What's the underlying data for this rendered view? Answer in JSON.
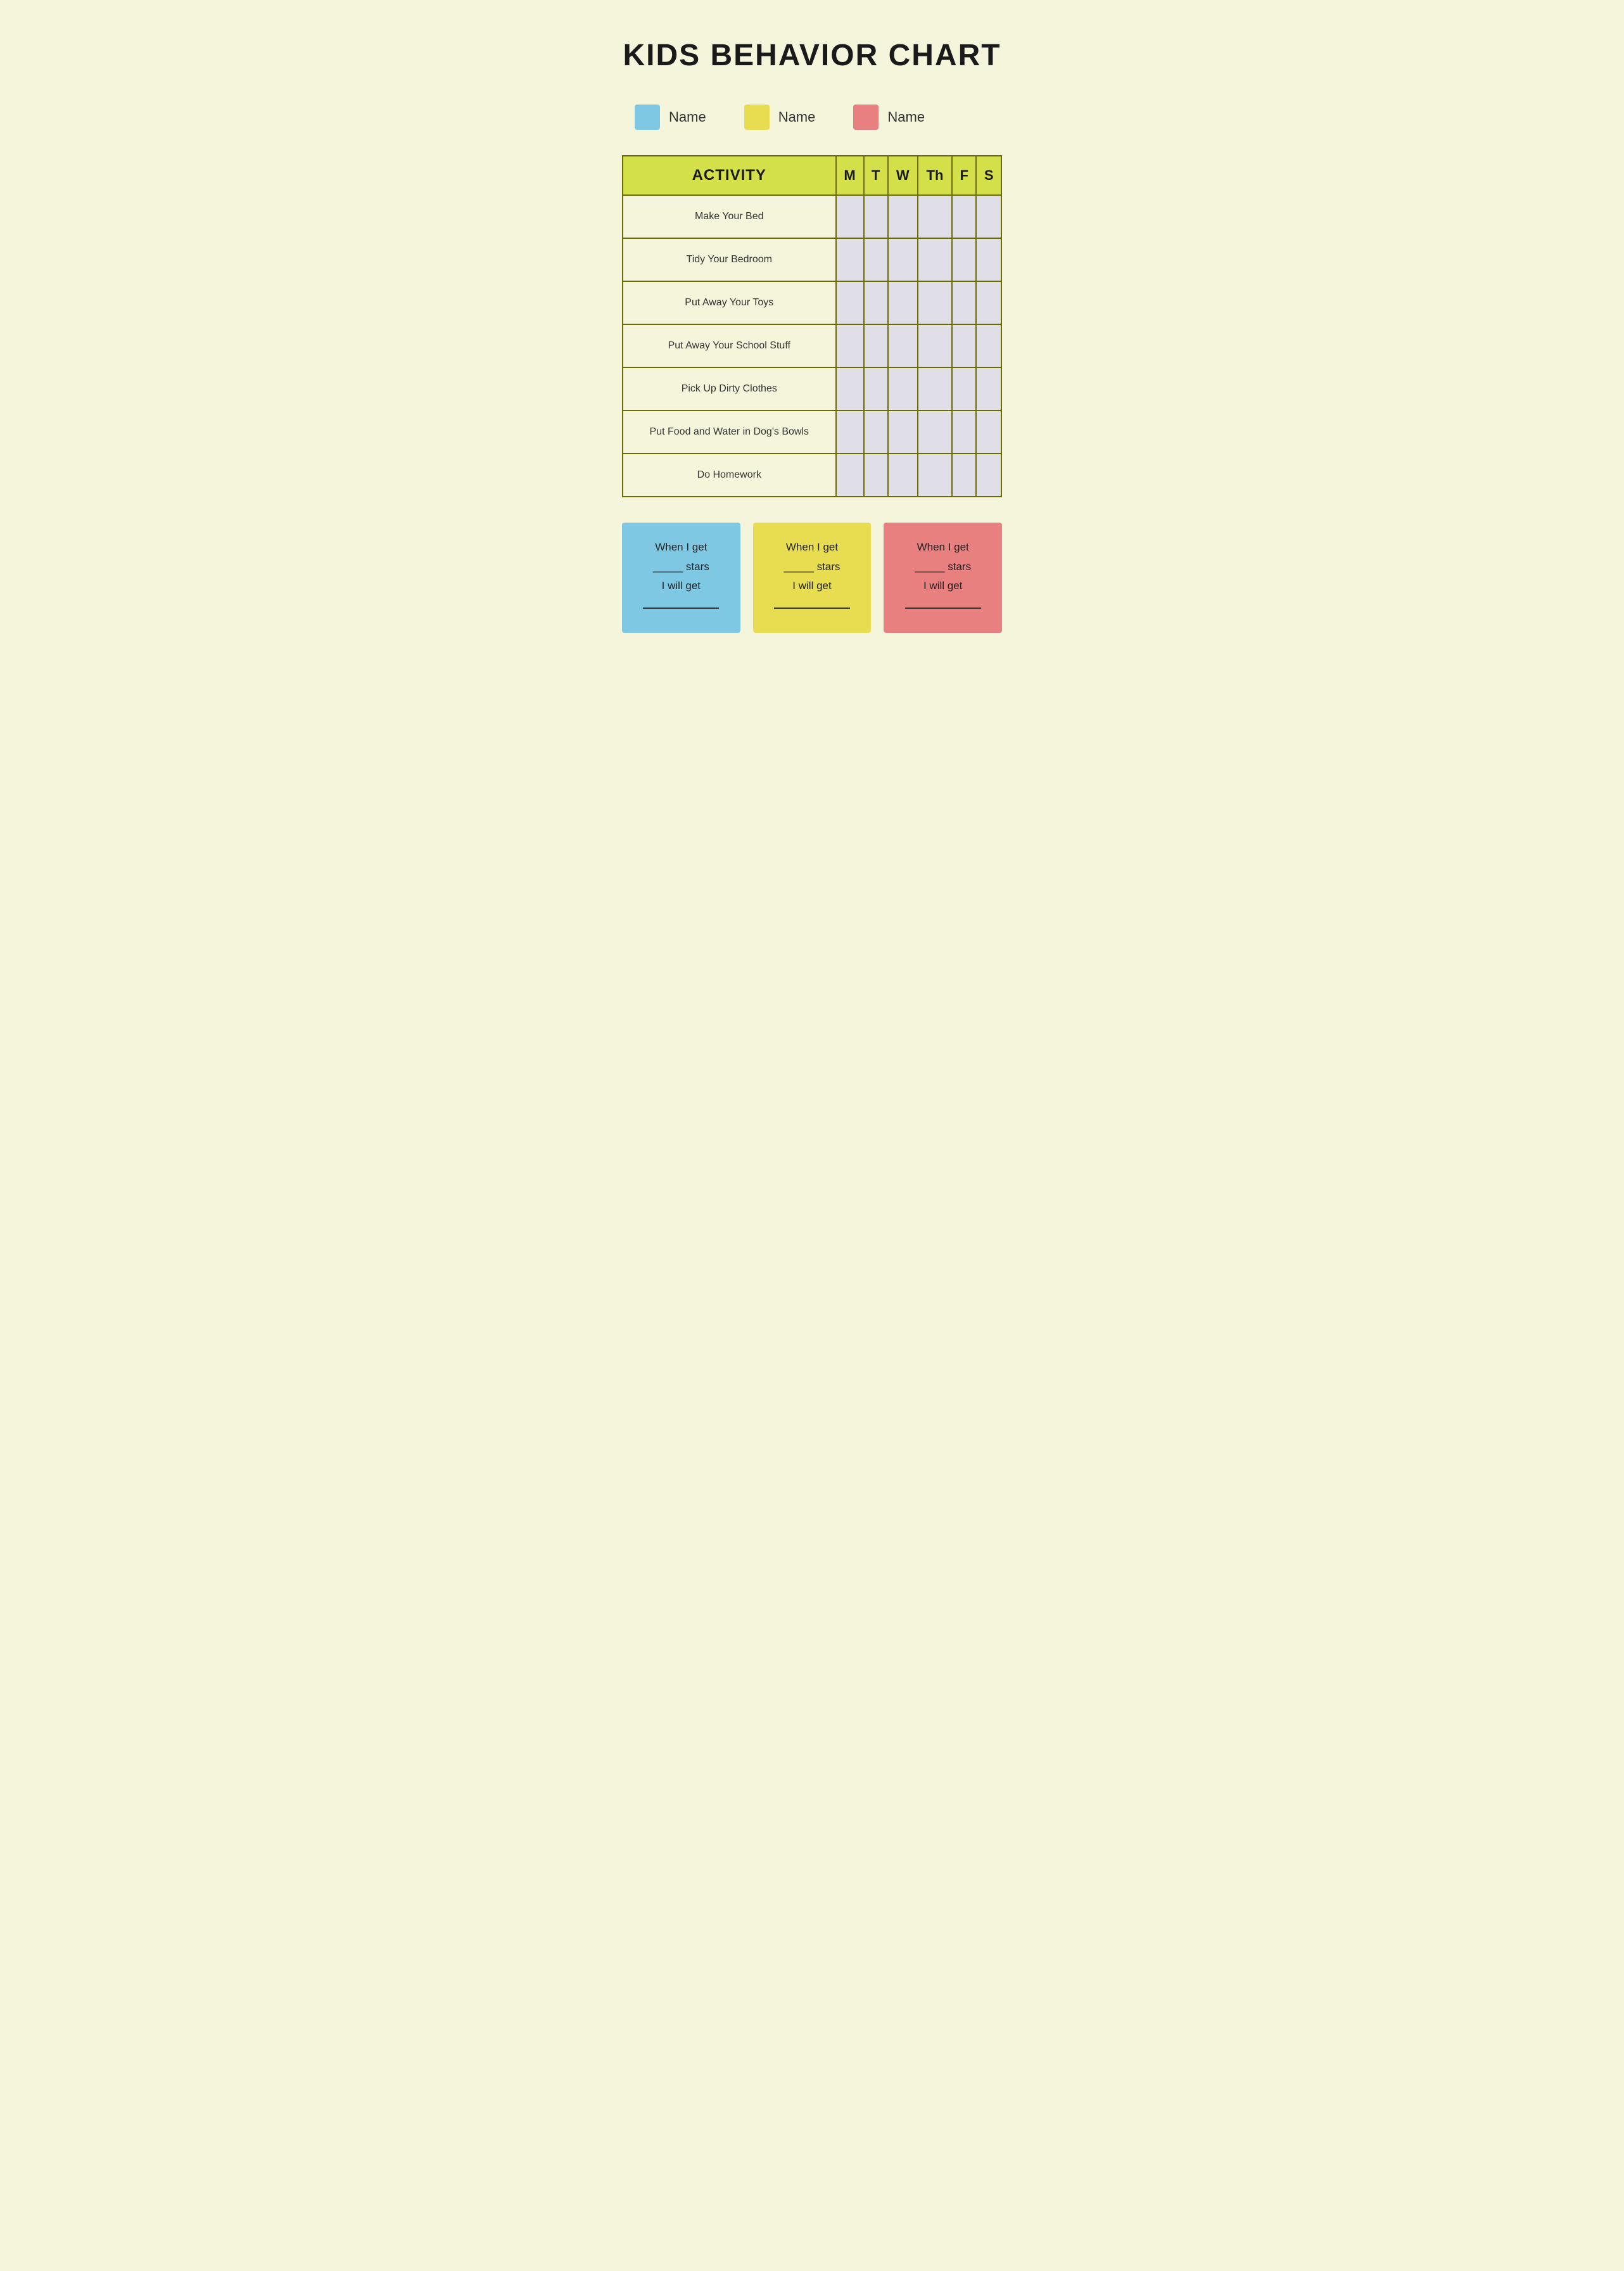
{
  "page": {
    "title": "KIDS BEHAVIOR CHART",
    "background_color": "#f5f5dc"
  },
  "legend": {
    "items": [
      {
        "id": "blue",
        "color": "#7ec8e3",
        "label": "Name"
      },
      {
        "id": "yellow",
        "color": "#e8dc50",
        "label": "Name"
      },
      {
        "id": "pink",
        "color": "#e88080",
        "label": "Name"
      }
    ]
  },
  "table": {
    "header": {
      "activity_label": "ACTIVITY",
      "days": [
        "M",
        "T",
        "W",
        "Th",
        "F",
        "S"
      ]
    },
    "rows": [
      {
        "activity": "Make Your Bed"
      },
      {
        "activity": "Tidy Your Bedroom"
      },
      {
        "activity": "Put Away Your Toys"
      },
      {
        "activity": "Put Away Your School Stuff"
      },
      {
        "activity": "Pick Up Dirty Clothes"
      },
      {
        "activity": "Put Food and Water in Dog's Bowls"
      },
      {
        "activity": "Do Homework"
      }
    ]
  },
  "rewards": [
    {
      "id": "blue",
      "color": "#7ec8e3",
      "line1": "When I get",
      "line2": "_____ stars",
      "line3": "I will get",
      "line4": "_______________"
    },
    {
      "id": "yellow",
      "color": "#e8dc50",
      "line1": "When I get",
      "line2": "_____ stars",
      "line3": "I will get",
      "line4": "_______________"
    },
    {
      "id": "pink",
      "color": "#e88080",
      "line1": "When I get",
      "line2": "_____ stars",
      "line3": "I will get",
      "line4": "_______________"
    }
  ]
}
